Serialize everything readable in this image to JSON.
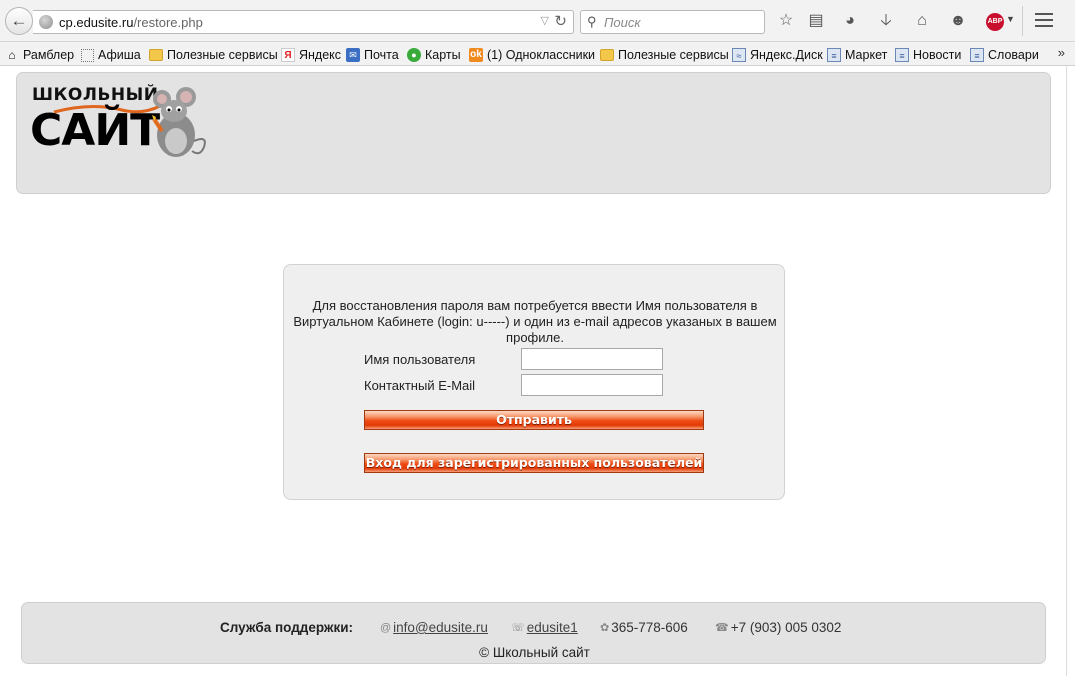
{
  "browser": {
    "url_host": "cp.edusite.ru",
    "url_path": "/restore.php",
    "search_placeholder": "Поиск",
    "icons": [
      "back-arrow-icon",
      "globe-icon",
      "reload-icon",
      "search-icon",
      "star-icon",
      "reading-list-icon",
      "pocket-icon",
      "download-icon",
      "home-icon",
      "chat-icon",
      "adblock-icon",
      "menu-icon"
    ],
    "adblock_label": "ABP"
  },
  "bookmarks": [
    {
      "label": "Рамблер",
      "icon": "home-icon"
    },
    {
      "label": "Афиша",
      "icon": "dotted-page-icon"
    },
    {
      "label": "Полезные сервисы",
      "icon": "folder-icon"
    },
    {
      "label": "Яндекс",
      "icon": "yandex-icon"
    },
    {
      "label": "Почта",
      "icon": "mail-icon"
    },
    {
      "label": "Карты",
      "icon": "maps-icon"
    },
    {
      "label": "(1) Одноклассники",
      "icon": "ok-icon"
    },
    {
      "label": "Полезные сервисы",
      "icon": "folder-icon"
    },
    {
      "label": "Яндекс.Диск",
      "icon": "disk-icon"
    },
    {
      "label": "Маркет",
      "icon": "market-icon"
    },
    {
      "label": "Новости",
      "icon": "news-icon"
    },
    {
      "label": "Словари",
      "icon": "dictionary-icon"
    }
  ],
  "logo": {
    "small": "ШКОЛЬНЫЙ",
    "big": "САЙТ"
  },
  "restore": {
    "description": "Для восстановления пароля вам потребуется ввести Имя пользователя в Виртуальном Кабинете (login: u-----) и один из e-mail адресов указаных в вашем профиле.",
    "username_label": "Имя пользователя",
    "username_value": "",
    "email_label": "Контактный E-Mail",
    "email_value": "",
    "submit_label": "Отправить",
    "login_label": "Вход для зарегистрированных пользователей",
    "button_color": "#e8430a"
  },
  "footer": {
    "support_title": "Служба поддержки:",
    "email": "info@edusite.ru",
    "skype": "edusite1",
    "icq": "365-778-606",
    "phone": "+7 (903) 005 0302",
    "copyright": "© Школьный сайт"
  }
}
